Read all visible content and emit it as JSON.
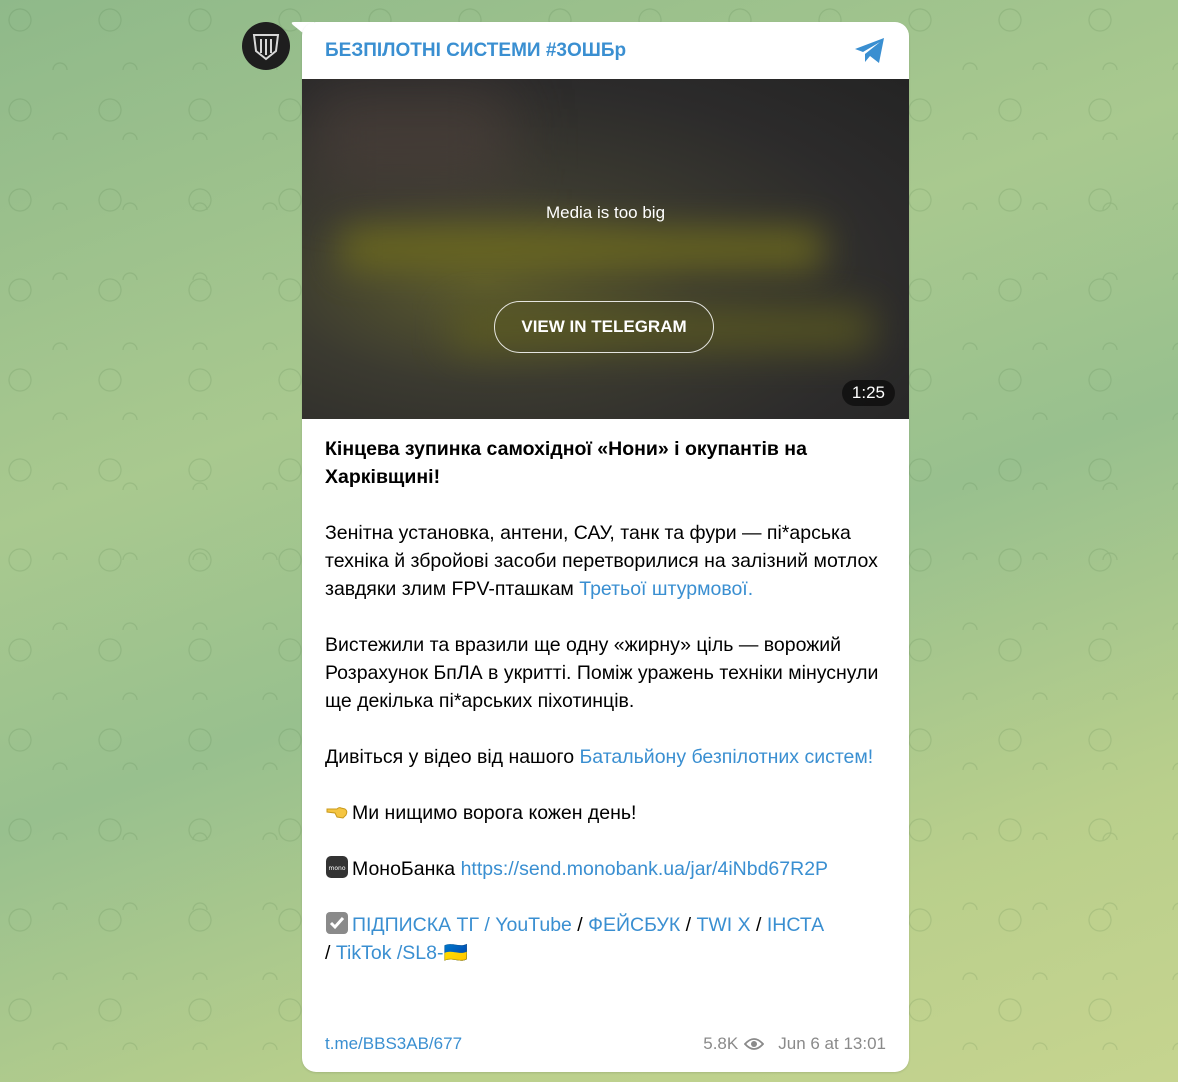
{
  "channel": {
    "name": "БЕЗПІЛОТНІ СИСТЕМИ #3ОШБр"
  },
  "media": {
    "notice": "Media is too big",
    "button": "VIEW IN TELEGRAM",
    "duration": "1:25"
  },
  "post": {
    "title": "Кінцева зупинка самохідної «Нони» і окупантів на Харківщині!",
    "p1_text": "Зенітна установка, антени, САУ, танк та фури — пі*арська техніка й збройові засоби перетворилися на залізний мотлох завдяки злим FPV-пташкам ",
    "p1_link": "Третьої штурмової.",
    "p2_text": "Вистежили та вразили ще одну «жирну» ціль — ворожий Розрахунок БпЛА в укритті. Поміж уражень техніки мінуснули ще декілька пі*арських піхотинців.",
    "p3_text": "Дивіться у відео від нашого ",
    "p3_link": "Батальйону безпілотних систем!",
    "p4_text": "Ми нищимо ворога кожен день!",
    "p5_text": "МоноБанка ",
    "p5_link": "https://send.monobank.ua/jar/4iNbd67R2P",
    "links": {
      "subscribe": "ПІДПИСКА ТГ / YouTube",
      "sep1": " / ",
      "facebook": "ФЕЙСБУК",
      "sep2": " / ",
      "twitter": "TWI X",
      "sep3": " / ",
      "instagram": "ІНСТА",
      "sep4": "/ ",
      "tiktok": "TikTok /SL8-",
      "flag": "🇺🇦"
    }
  },
  "footer": {
    "permalink": "t.me/BBS3AB/677",
    "views": "5.8K",
    "date": "Jun 6 at 13:01"
  },
  "icons": {
    "avatar": "channel-logo-icon",
    "telegram": "telegram-plane-icon",
    "views": "eye-icon"
  },
  "colors": {
    "accent": "#3a8fd1",
    "meta": "#8a8a8a"
  }
}
